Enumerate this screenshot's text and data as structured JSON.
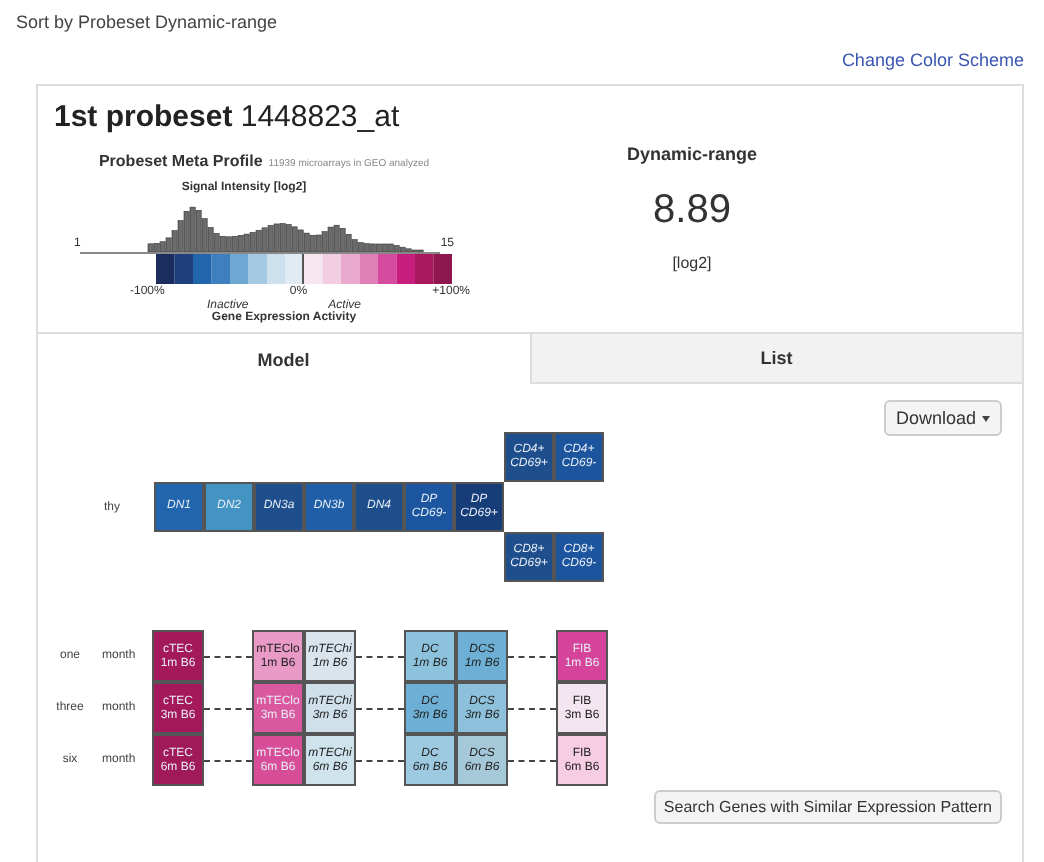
{
  "header": {
    "sort_label": "Sort by Probeset Dynamic-range",
    "color_link": "Change Color Scheme"
  },
  "probeset": {
    "rank": "1st probeset",
    "id": "1448823_at",
    "meta_profile": {
      "title": "Probeset Meta Profile",
      "subtitle": "11939 microarrays in GEO analyzed",
      "chart_title": "Signal Intensity [log2]",
      "axis_min": "1",
      "axis_max": "15",
      "scale_labels": [
        "-100%",
        "0%",
        "+100%"
      ],
      "inactive": "Inactive",
      "active": "Active",
      "axis_title": "Gene Expression Activity"
    },
    "dynamic_range": {
      "title": "Dynamic-range",
      "value": "8.89",
      "unit": "[log2]"
    }
  },
  "tabs": [
    {
      "label": "Model",
      "selected": true
    },
    {
      "label": "List",
      "selected": false
    }
  ],
  "download_button": "Download",
  "thymus": {
    "label": "thy",
    "main": [
      {
        "lines": [
          "DN1"
        ],
        "color": "#2166ac",
        "italic": true
      },
      {
        "lines": [
          "DN2"
        ],
        "color": "#4393c3",
        "italic": true
      },
      {
        "lines": [
          "DN3a"
        ],
        "color": "#1e4f8c",
        "italic": true
      },
      {
        "lines": [
          "DN3b"
        ],
        "color": "#1f5fa8",
        "italic": true
      },
      {
        "lines": [
          "DN4"
        ],
        "color": "#1e4f8c",
        "italic": true
      },
      {
        "lines": [
          "DP",
          "CD69-"
        ],
        "color": "#1c55a0",
        "italic": true
      },
      {
        "lines": [
          "DP",
          "CD69+"
        ],
        "color": "#173d78",
        "italic": true
      }
    ],
    "upper": [
      {
        "lines": [
          "CD4+",
          "CD69+"
        ],
        "color": "#1e4f8c",
        "italic": true
      },
      {
        "lines": [
          "CD4+",
          "CD69-"
        ],
        "color": "#1c559e",
        "italic": true
      }
    ],
    "lower": [
      {
        "lines": [
          "CD8+",
          "CD69+"
        ],
        "color": "#1e4f8c",
        "italic": true
      },
      {
        "lines": [
          "CD8+",
          "CD69-"
        ],
        "color": "#1c559e",
        "italic": true
      }
    ]
  },
  "months": [
    {
      "labels": [
        "one",
        "month"
      ],
      "groups": [
        [
          {
            "lines": [
              "cTEC",
              "1m B6"
            ],
            "color": "#a3195b",
            "italic": false
          }
        ],
        [
          {
            "lines": [
              "mTEClo",
              "1m B6"
            ],
            "color": "#e99ac6",
            "italic": false
          },
          {
            "lines": [
              "mTEChi",
              "1m B6"
            ],
            "color": "#d9e4ec",
            "italic": true
          }
        ],
        [
          {
            "lines": [
              "DC",
              "1m B6"
            ],
            "color": "#8cc2dc",
            "italic": true
          },
          {
            "lines": [
              "DCS",
              "1m B6"
            ],
            "color": "#6eb0d5",
            "italic": true
          }
        ],
        [
          {
            "lines": [
              "FIB",
              "1m B6"
            ],
            "color": "#d6439a",
            "italic": false
          }
        ]
      ]
    },
    {
      "labels": [
        "three",
        "month"
      ],
      "groups": [
        [
          {
            "lines": [
              "cTEC",
              "3m B6"
            ],
            "color": "#a3195b",
            "italic": false
          }
        ],
        [
          {
            "lines": [
              "mTEClo",
              "3m B6"
            ],
            "color": "#d9589f",
            "italic": false
          },
          {
            "lines": [
              "mTEChi",
              "3m B6"
            ],
            "color": "#cfe0ea",
            "italic": true
          }
        ],
        [
          {
            "lines": [
              "DC",
              "3m B6"
            ],
            "color": "#6eb0d5",
            "italic": true
          },
          {
            "lines": [
              "DCS",
              "3m B6"
            ],
            "color": "#8dc0db",
            "italic": true
          }
        ],
        [
          {
            "lines": [
              "FIB",
              "3m B6"
            ],
            "color": "#f4e6f0",
            "italic": false
          }
        ]
      ]
    },
    {
      "labels": [
        "six",
        "month"
      ],
      "groups": [
        [
          {
            "lines": [
              "cTEC",
              "6m B6"
            ],
            "color": "#a01a5a",
            "italic": false
          }
        ],
        [
          {
            "lines": [
              "mTEClo",
              "6m B6"
            ],
            "color": "#d74d98",
            "italic": false
          },
          {
            "lines": [
              "mTEChi",
              "6m B6"
            ],
            "color": "#cfe3ec",
            "italic": true
          }
        ],
        [
          {
            "lines": [
              "DC",
              "6m B6"
            ],
            "color": "#9ecae1",
            "italic": true
          },
          {
            "lines": [
              "DCS",
              "6m B6"
            ],
            "color": "#a6c9da",
            "italic": true
          }
        ],
        [
          {
            "lines": [
              "FIB",
              "6m B6"
            ],
            "color": "#f6cde2",
            "italic": false
          }
        ]
      ]
    }
  ],
  "search_button": "Search Genes with Similar Expression Pattern"
}
